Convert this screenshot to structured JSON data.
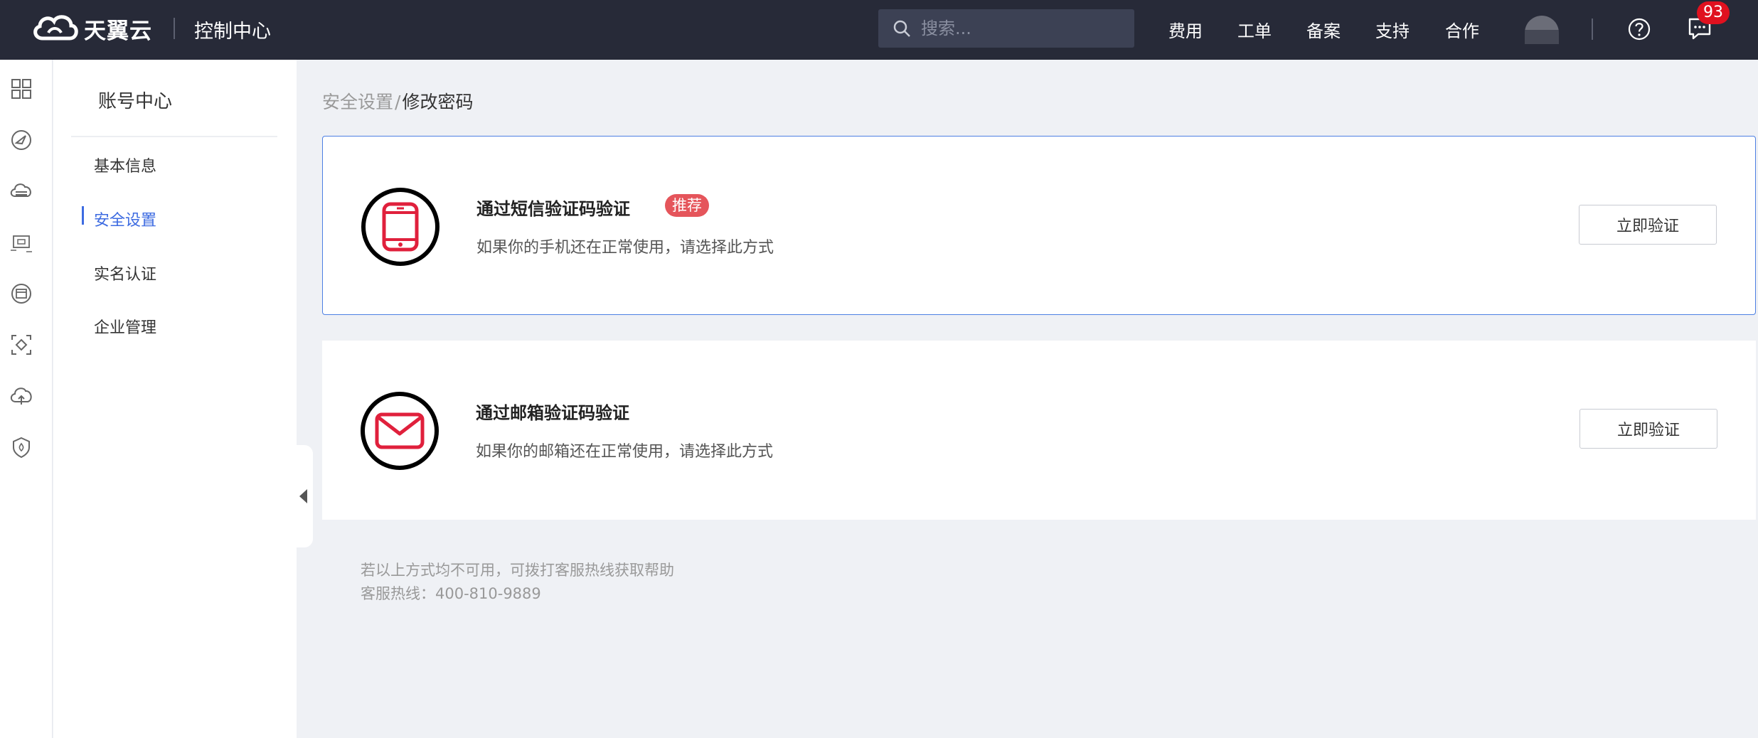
{
  "header": {
    "brand": "天翼云",
    "console_title": "控制中心",
    "search_placeholder": "搜索...",
    "nav": [
      "费用",
      "工单",
      "备案",
      "支持",
      "合作"
    ],
    "notification_count": "93",
    "icons": [
      "cloud-logo-icon",
      "search-icon",
      "avatar",
      "help-icon",
      "message-icon"
    ]
  },
  "rail": {
    "icons": [
      "dashboard-grid-icon",
      "compass-icon",
      "cloud-server-icon",
      "vpc-network-icon",
      "window-icon",
      "container-icon",
      "cloud-upload-icon",
      "security-shield-icon"
    ]
  },
  "sidebar": {
    "title": "账号中心",
    "items": [
      {
        "label": "基本信息",
        "active": false
      },
      {
        "label": "安全设置",
        "active": true
      },
      {
        "label": "实名认证",
        "active": false
      },
      {
        "label": "企业管理",
        "active": false
      }
    ]
  },
  "breadcrumb": {
    "parent": "安全设置",
    "separator": "/",
    "current": "修改密码"
  },
  "methods": [
    {
      "title": "通过短信验证码验证",
      "tag": "推荐",
      "description": "如果你的手机还在正常使用，请选择此方式",
      "button": "立即验证",
      "icon": "phone-icon"
    },
    {
      "title": "通过邮箱验证码验证",
      "description": "如果你的邮箱还在正常使用，请选择此方式",
      "button": "立即验证",
      "icon": "email-icon"
    }
  ],
  "help": {
    "line1": "若以上方式均不可用，可拨打客服热线获取帮助",
    "line2": "客服热线：400-810-9889"
  },
  "colors": {
    "topbar": "#272a38",
    "accent": "#3d6be1",
    "tag": "#e5555b",
    "icon_red": "#e0203c",
    "badge": "#e0111f"
  }
}
